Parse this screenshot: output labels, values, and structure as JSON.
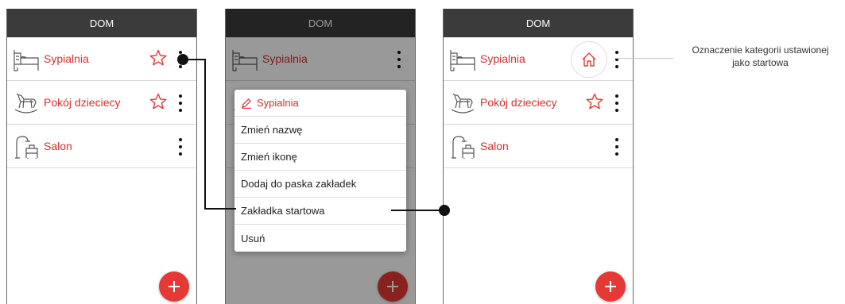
{
  "app_title": "DOM",
  "rooms": [
    {
      "label": "Sypialnia",
      "icon": "bed-icon"
    },
    {
      "label": "Pokój dzieciecy",
      "icon": "rocking-horse-icon"
    },
    {
      "label": "Salon",
      "icon": "lamp-armchair-icon"
    }
  ],
  "context_menu": {
    "header": "Sypialnia",
    "items": [
      "Zmień nazwę",
      "Zmień ikonę",
      "Dodaj do paska zakładek",
      "Zakładka startowa",
      "Usuń"
    ]
  },
  "annotation": {
    "line1": "Oznaczenie kategorii ustawionej",
    "line2": "jako startowa"
  },
  "colors": {
    "accent": "#e53935",
    "label": "#d32f2f",
    "topbar": "#3b3b3b"
  }
}
